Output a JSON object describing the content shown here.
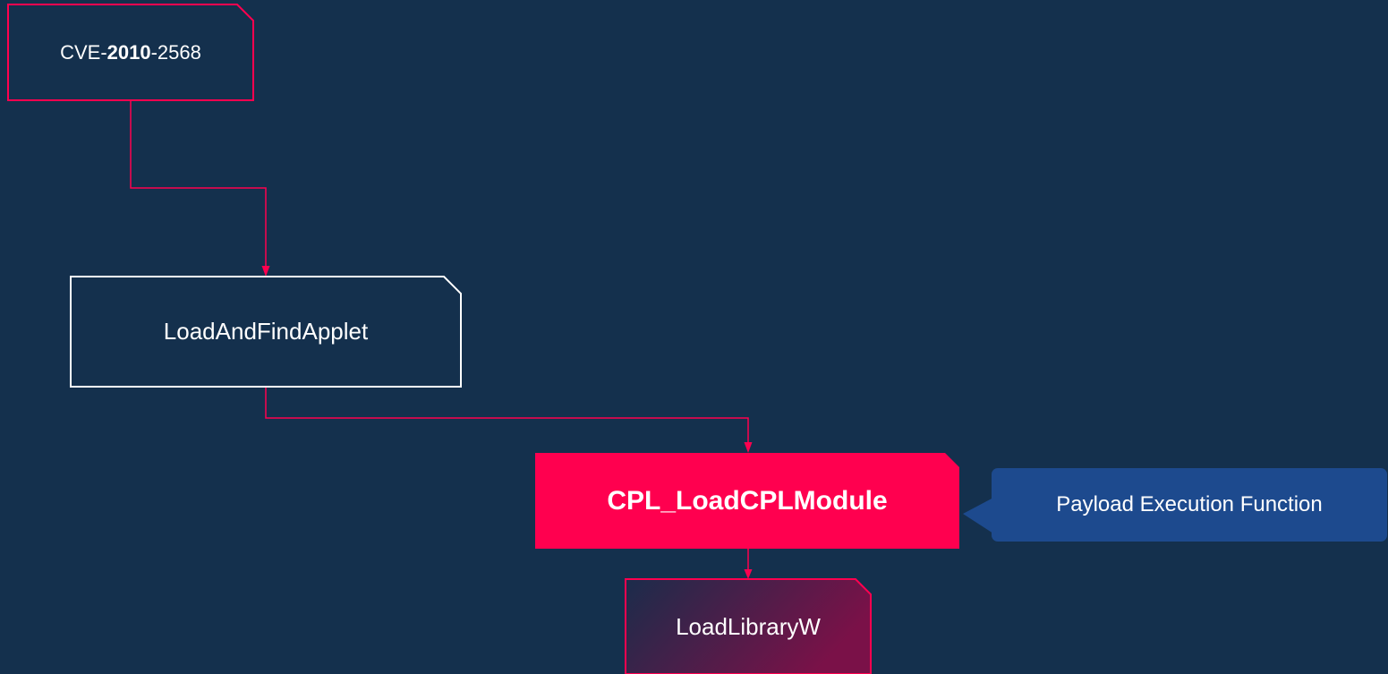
{
  "diagram": {
    "nodes": {
      "cve": {
        "prefix": "CVE-",
        "year": "2010",
        "suffix": "-2568"
      },
      "load_and_find_applet": {
        "label": "LoadAndFindApplet"
      },
      "cpl_load_cpl_module": {
        "label": "CPL_LoadCPLModule"
      },
      "load_library_w": {
        "label": "LoadLibraryW"
      }
    },
    "callout": {
      "label": "Payload Execution Function"
    },
    "colors": {
      "background": "#14304d",
      "accent_red": "#ff004f",
      "node_outline_white": "#ffffff",
      "callout_blue": "#1d4a8e",
      "gradient_start": "#1b2c4b",
      "gradient_end": "#7a1148"
    }
  }
}
